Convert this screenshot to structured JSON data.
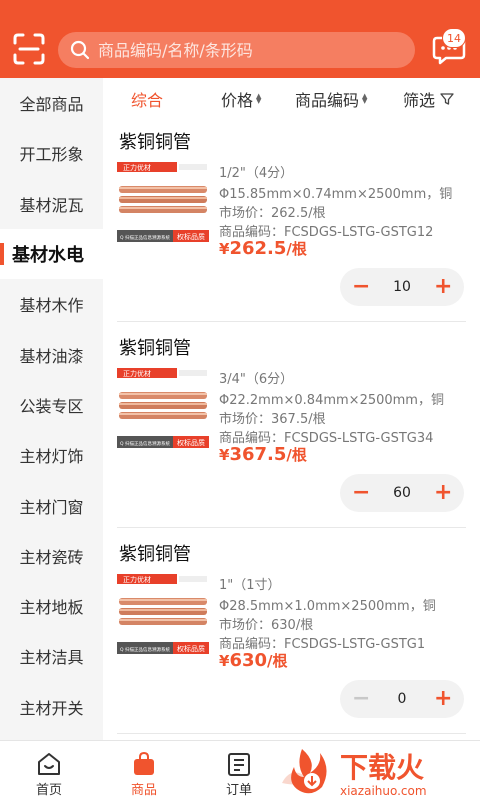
{
  "header": {
    "search_placeholder": "商品编码/名称/条形码",
    "message_count": "14"
  },
  "sidebar": {
    "items": [
      {
        "label": "全部商品"
      },
      {
        "label": "开工形象"
      },
      {
        "label": "基材泥瓦"
      },
      {
        "label": "基材水电",
        "active": true
      },
      {
        "label": "基材木作"
      },
      {
        "label": "基材油漆"
      },
      {
        "label": "公装专区"
      },
      {
        "label": "主材灯饰"
      },
      {
        "label": "主材门窗"
      },
      {
        "label": "主材瓷砖"
      },
      {
        "label": "主材地板"
      },
      {
        "label": "主材洁具"
      },
      {
        "label": "主材开关"
      }
    ]
  },
  "sortbar": {
    "overall": "综合",
    "price": "价格",
    "code": "商品编码",
    "filter": "筛选"
  },
  "products": [
    {
      "title": "紫铜铜管",
      "spec": "1/2\"（4分）",
      "size": "Φ15.85mm×0.74mm×2500mm，铜",
      "market": "市场价：262.5/根",
      "code": "商品编码：FCSDGS-LSTG-GSTG12",
      "price_currency": "¥",
      "price_value": "262.5",
      "price_unit": "/根",
      "qty": "10",
      "minus_disabled": false
    },
    {
      "title": "紫铜铜管",
      "spec": "3/4\"（6分）",
      "size": "Φ22.2mm×0.84mm×2500mm，铜",
      "market": "市场价：367.5/根",
      "code": "商品编码：FCSDGS-LSTG-GSTG34",
      "price_currency": "¥",
      "price_value": "367.5",
      "price_unit": "/根",
      "qty": "60",
      "minus_disabled": false
    },
    {
      "title": "紫铜铜管",
      "spec": "1\"（1寸）",
      "size": "Φ28.5mm×1.0mm×2500mm，铜",
      "market": "市场价：630/根",
      "code": "商品编码：FCSDGS-LSTG-GSTG1",
      "price_currency": "¥",
      "price_value": "630",
      "price_unit": "/根",
      "qty": "0",
      "minus_disabled": true
    }
  ],
  "product_image": {
    "brand_text": "正力优材",
    "badge_text": "权标品质",
    "bar_text": "Q 扫描正品信息溯源系统"
  },
  "tabbar": {
    "home": "首页",
    "goods": "商品",
    "orders": "订单"
  },
  "watermark": {
    "text": "下载火",
    "domain": "xiazaihuo.com"
  },
  "colors": {
    "accent": "#f0542e"
  }
}
